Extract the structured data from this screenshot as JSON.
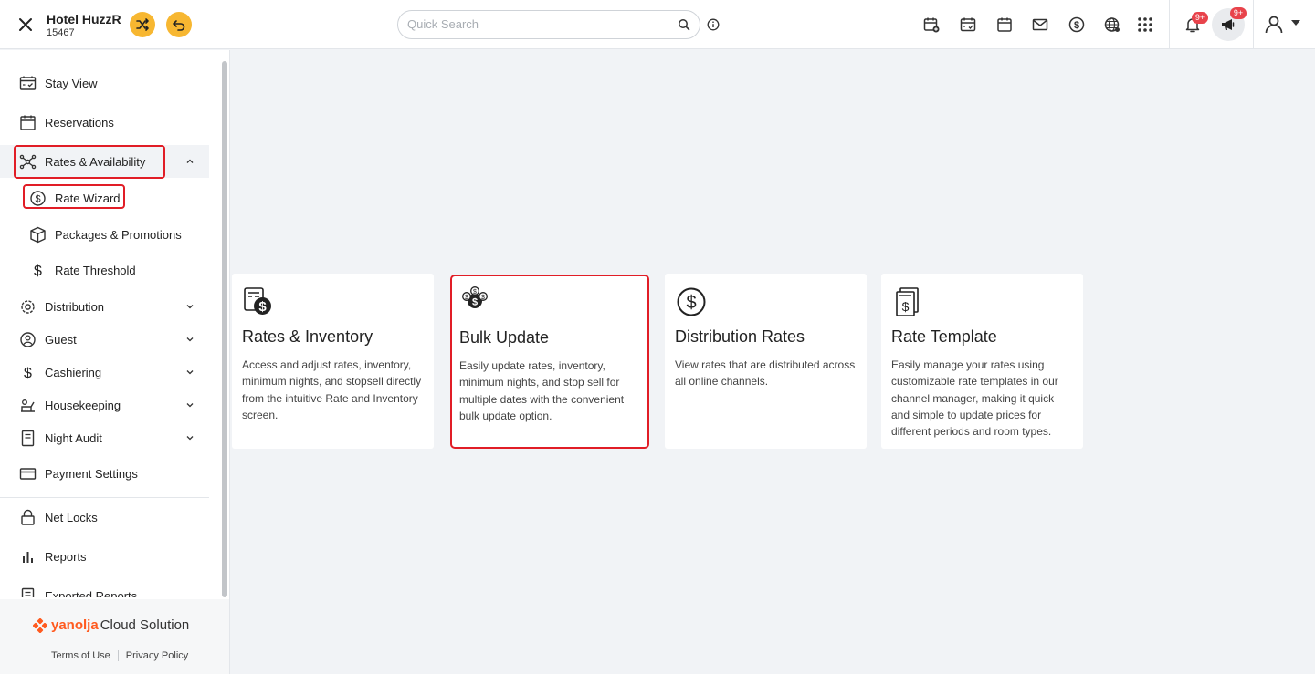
{
  "header": {
    "hotel_name": "Hotel HuzzR",
    "hotel_id": "15467",
    "search_placeholder": "Quick Search",
    "notifications_badge": "9+",
    "announcements_badge": "9+"
  },
  "sidebar": {
    "items": [
      {
        "label": "Stay View"
      },
      {
        "label": "Reservations"
      },
      {
        "label": "Rates & Availability"
      },
      {
        "label": "Rate Wizard"
      },
      {
        "label": "Packages & Promotions"
      },
      {
        "label": "Rate Threshold"
      },
      {
        "label": "Distribution"
      },
      {
        "label": "Guest"
      },
      {
        "label": "Cashiering"
      },
      {
        "label": "Housekeeping"
      },
      {
        "label": "Night Audit"
      },
      {
        "label": "Payment Settings"
      },
      {
        "label": "Net Locks"
      },
      {
        "label": "Reports"
      },
      {
        "label": "Exported Reports"
      }
    ],
    "footer": {
      "brand_part1": "yanolja",
      "brand_part2": "Cloud Solution",
      "terms": "Terms of Use",
      "privacy": "Privacy Policy"
    }
  },
  "cards": [
    {
      "title": "Rates & Inventory",
      "description": "Access and adjust rates, inventory, minimum nights, and stopsell directly from the intuitive Rate and Inventory screen."
    },
    {
      "title": "Bulk Update",
      "description": "Easily update rates, inventory, minimum nights, and stop sell for multiple dates with the convenient bulk update option."
    },
    {
      "title": "Distribution Rates",
      "description": "View rates that are distributed across all online channels."
    },
    {
      "title": "Rate Template",
      "description": "Easily manage your rates using customizable rate templates in our channel manager, making it quick and simple to update prices for different periods and room types."
    }
  ],
  "colors": {
    "accent_yellow": "#f7b731",
    "highlight_red": "#e11d26",
    "brand_orange": "#ff5a1f",
    "badge_red": "#e8434b"
  }
}
